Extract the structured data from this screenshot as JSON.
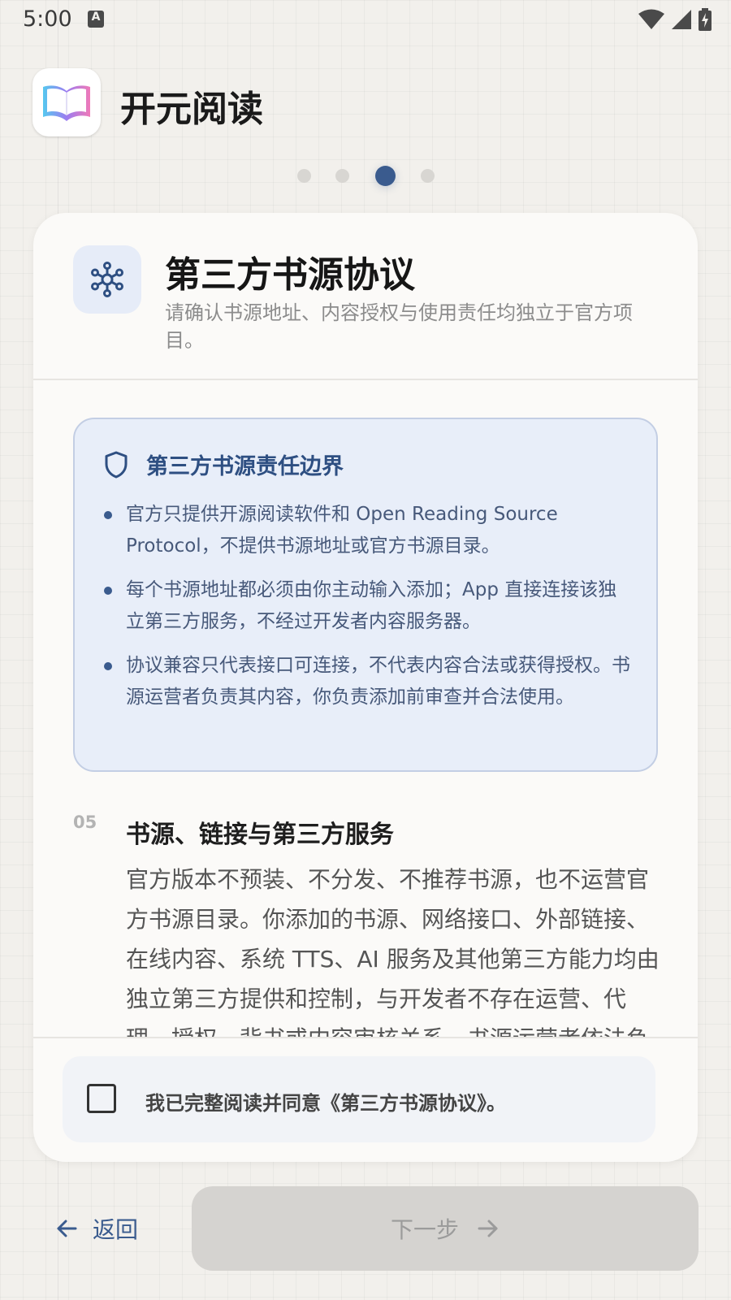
{
  "status_bar": {
    "time": "5:00",
    "notification_letter": "A",
    "icons": [
      "wifi-icon",
      "cell-signal-icon",
      "battery-charging-icon"
    ]
  },
  "header": {
    "app_name": "开元阅读",
    "app_icon": "open-book-icon"
  },
  "pager": {
    "total_steps": 4,
    "current_step": 3
  },
  "card": {
    "icon": "network-hub-icon",
    "title": "第三方书源协议",
    "subtitle": "请确认书源地址、内容授权与使用责任均独立于官方项目。"
  },
  "notice": {
    "icon": "shield-icon",
    "title": "第三方书源责任边界",
    "items": [
      "官方只提供开源阅读软件和 Open Reading Source Protocol，不提供书源地址或官方书源目录。",
      "每个书源地址都必须由你主动输入添加；App 直接连接该独立第三方服务，不经过开发者内容服务器。",
      "协议兼容只代表接口可连接，不代表内容合法或获得授权。书源运营者负责其内容，你负责添加前审查并合法使用。"
    ]
  },
  "section": {
    "number": "05",
    "title": "书源、链接与第三方服务",
    "body": "官方版本不预装、不分发、不推荐书源，也不运营官方书源目录。你添加的书源、网络接口、外部链接、在线内容、系统 TTS、AI 服务及其他第三方能力均由独立第三方提供和控制，与开发者不存在运营、代理、授权、背书或内容审核关系。书源运营者依法负"
  },
  "agreement": {
    "label": "我已完整阅读并同意《第三方书源协议》。",
    "checked": false
  },
  "nav": {
    "back_label": "返回",
    "next_label": "下一步"
  },
  "colors": {
    "accent": "#3a5b8e",
    "background": "#f2f0ec",
    "notice_bg": "#e8eef9",
    "disabled_button": "#d5d3d0"
  }
}
